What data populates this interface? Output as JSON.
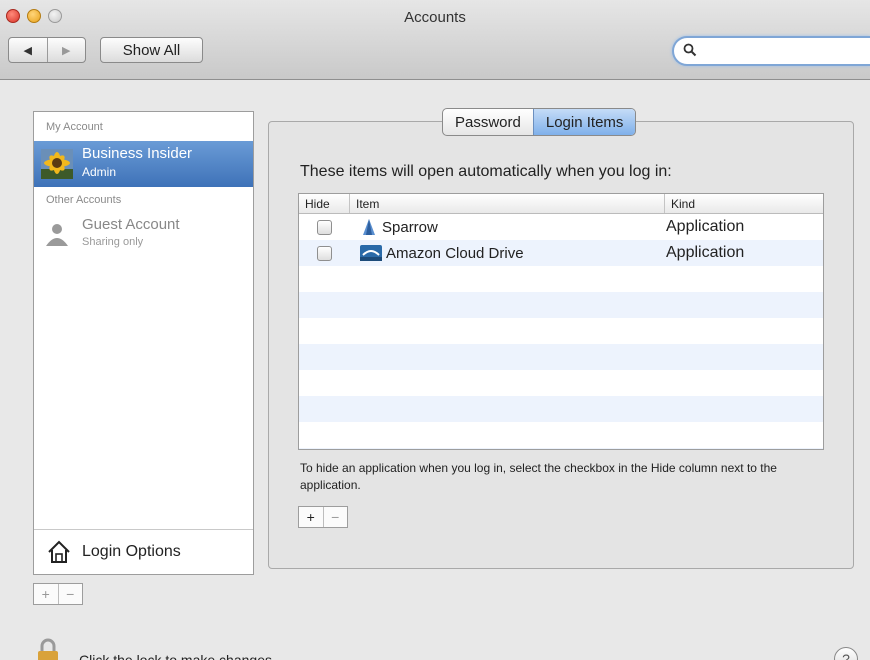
{
  "window": {
    "title": "Accounts"
  },
  "toolbar": {
    "back_glyph": "◀",
    "forward_glyph": "▶",
    "show_all_label": "Show All",
    "search_value": "",
    "search_placeholder": ""
  },
  "sidebar": {
    "my_account_header": "My Account",
    "other_accounts_header": "Other Accounts",
    "accounts": [
      {
        "name": "Business Insider",
        "role": "Admin",
        "selected": true
      },
      {
        "name": "Guest Account",
        "role": "Sharing only",
        "selected": false
      }
    ],
    "login_options_label": "Login Options",
    "add_glyph": "+",
    "remove_glyph": "−"
  },
  "tabs": [
    {
      "label": "Password",
      "active": false
    },
    {
      "label": "Login Items",
      "active": true
    }
  ],
  "login_items": {
    "intro": "These items will open automatically when you log in:",
    "columns": {
      "hide": "Hide",
      "item": "Item",
      "kind": "Kind"
    },
    "rows": [
      {
        "name": "Sparrow",
        "kind": "Application",
        "hidden": false,
        "icon": "sparrow-app-icon"
      },
      {
        "name": "Amazon Cloud Drive",
        "kind": "Application",
        "hidden": false,
        "icon": "amazon-cloud-drive-icon"
      }
    ],
    "hint": "To hide an application when you log in, select the checkbox in the Hide column next to the application.",
    "add_glyph": "+",
    "remove_glyph": "−"
  },
  "footer": {
    "lock_text": "Click the lock to make changes.",
    "help_glyph": "?"
  },
  "colors": {
    "selection": "#3e72b8",
    "alt_row": "#edf3fd",
    "active_tab": "#7fb0ea"
  }
}
